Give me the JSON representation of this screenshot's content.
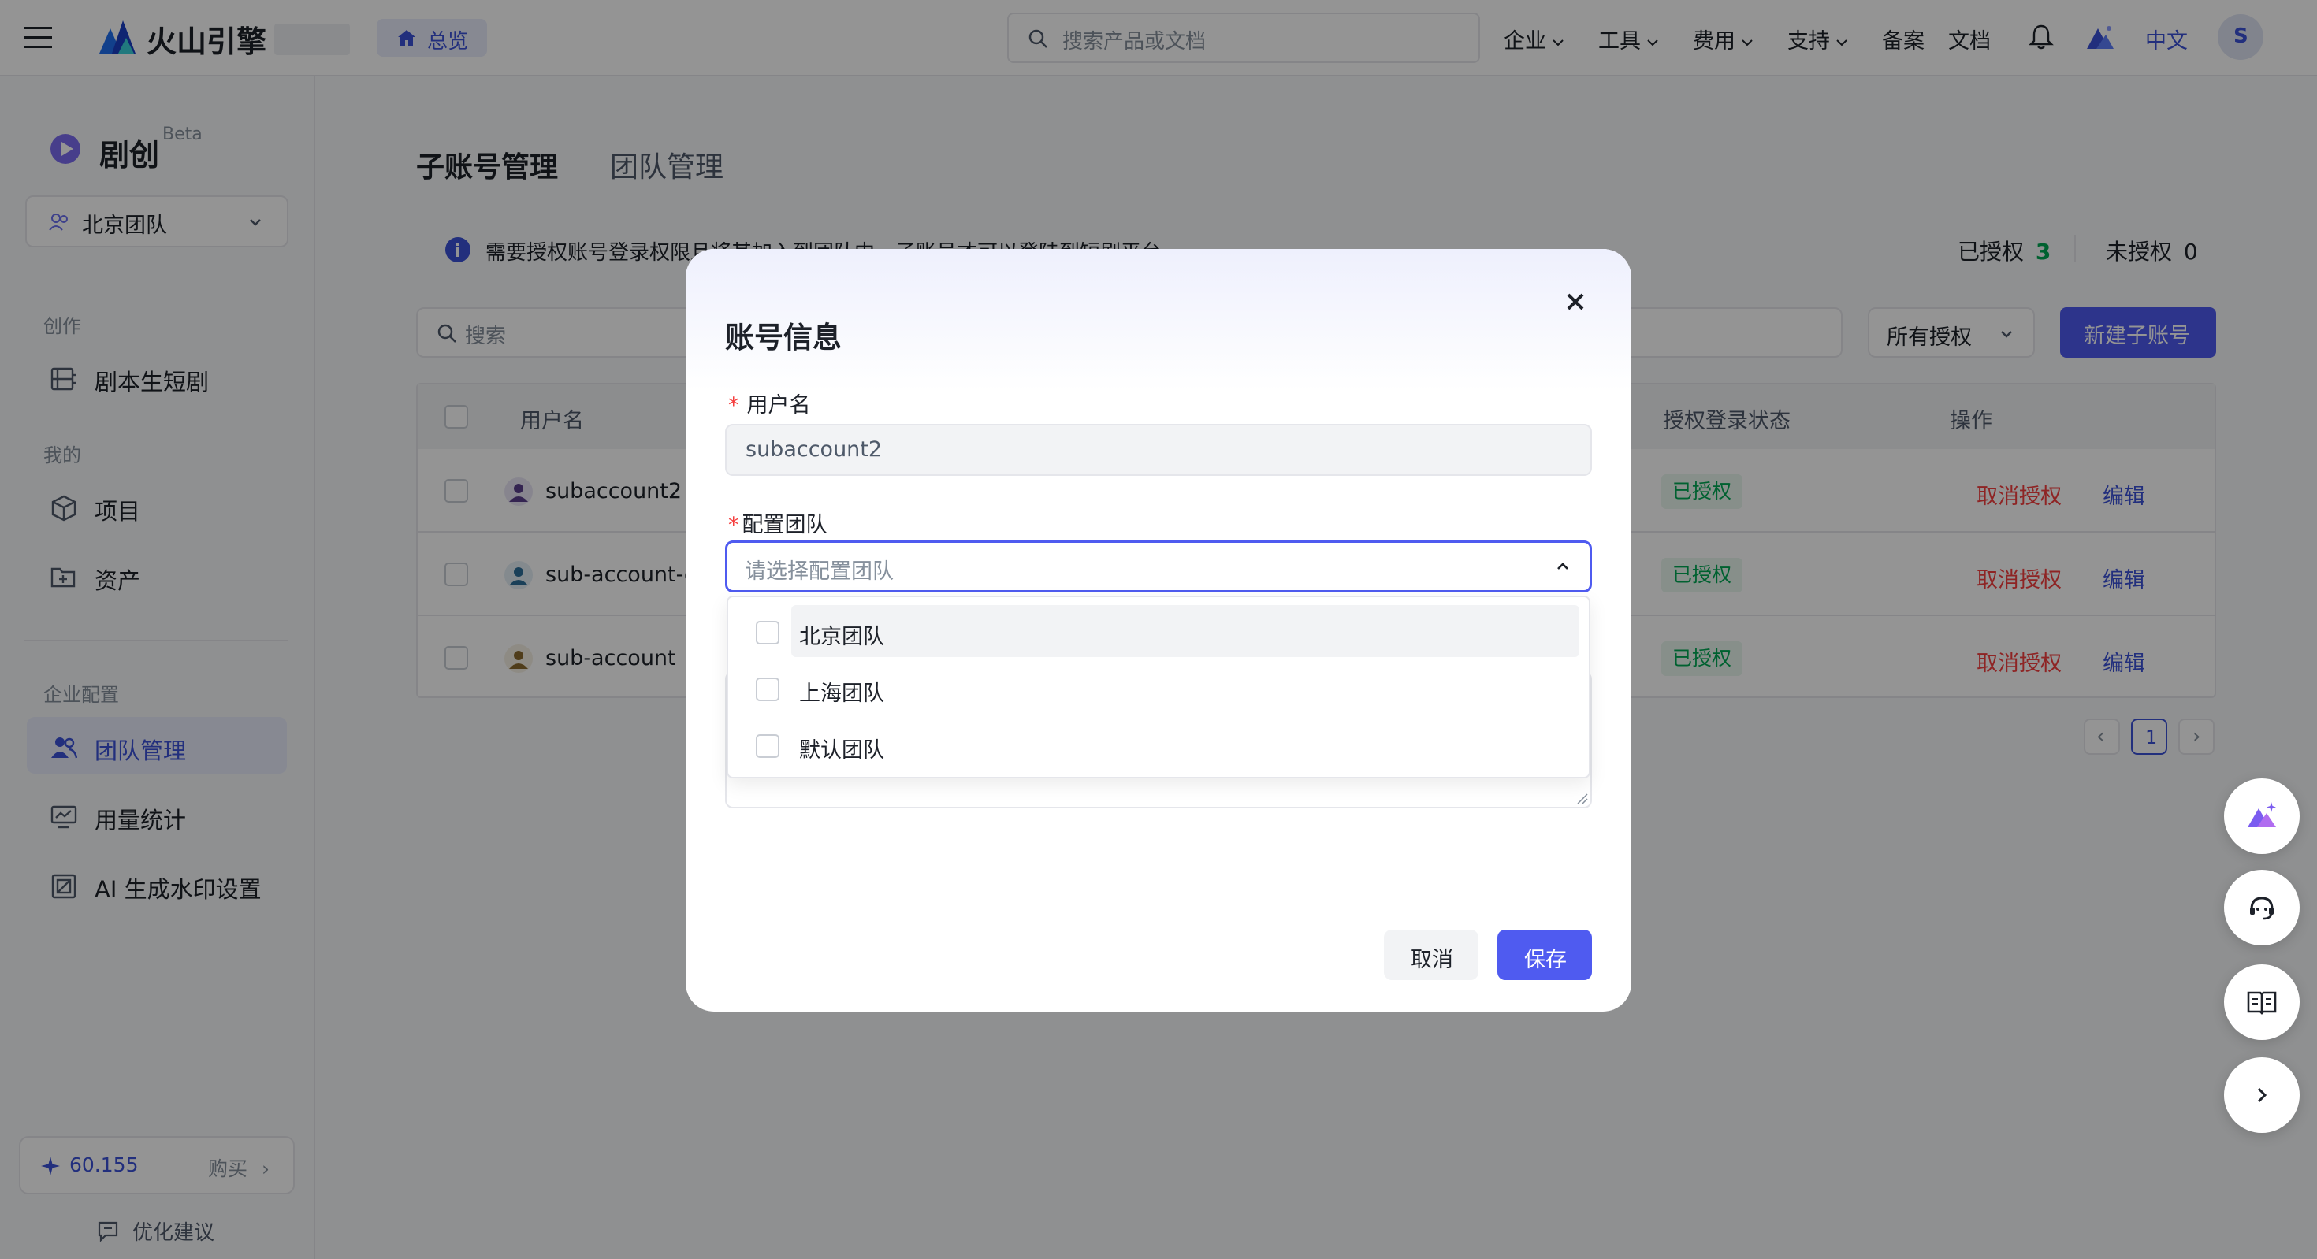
{
  "topbar": {
    "brand": "火山引擎",
    "overview": "总览",
    "search_placeholder": "搜索产品或文档",
    "nav": [
      "企业",
      "工具",
      "费用",
      "支持"
    ],
    "plain_nav": [
      "备案",
      "文档"
    ],
    "lang": "中文",
    "avatar_letter": "S"
  },
  "sidebar": {
    "app_name": "剧创",
    "beta": "Beta",
    "team_selected": "北京团队",
    "sections": {
      "create": "创作",
      "mine": "我的",
      "enterprise": "企业配置"
    },
    "items": {
      "script": "剧本生短剧",
      "project": "项目",
      "assets": "资产",
      "team": "团队管理",
      "usage": "用量统计",
      "watermark": "AI 生成水印设置"
    },
    "credits": "60.155",
    "buy": "购买",
    "feedback": "优化建议"
  },
  "main": {
    "tabs": [
      "子账号管理",
      "团队管理"
    ],
    "info_text": "需要授权账号登录权限且将其加入到团队中，子账号才可以登陆到短剧平台",
    "authorized_label": "已授权",
    "authorized_count": "3",
    "unauthorized_label": "未授权",
    "unauthorized_count": "0",
    "search_placeholder": "搜索",
    "filter": "所有授权",
    "new_button": "新建子账号",
    "columns": {
      "username": "用户名",
      "status": "授权登录状态",
      "actions": "操作"
    },
    "rows": [
      {
        "username": "subaccount2",
        "status": "已授权",
        "revoke": "取消授权",
        "edit": "编辑"
      },
      {
        "username": "sub-account-ow",
        "status": "已授权",
        "revoke": "取消授权",
        "edit": "编辑"
      },
      {
        "username": "sub-account",
        "status": "已授权",
        "revoke": "取消授权",
        "edit": "编辑"
      }
    ],
    "page": "1"
  },
  "modal": {
    "title": "账号信息",
    "username_label": "用户名",
    "username_value": "subaccount2",
    "team_label": "配置团队",
    "team_placeholder": "请选择配置团队",
    "options": [
      "北京团队",
      "上海团队",
      "默认团队"
    ],
    "cancel": "取消",
    "save": "保存"
  },
  "colors": {
    "primary": "#4f5bf0",
    "link_blue": "#3c52d8",
    "danger": "#f53f3f",
    "success": "#00a854"
  }
}
